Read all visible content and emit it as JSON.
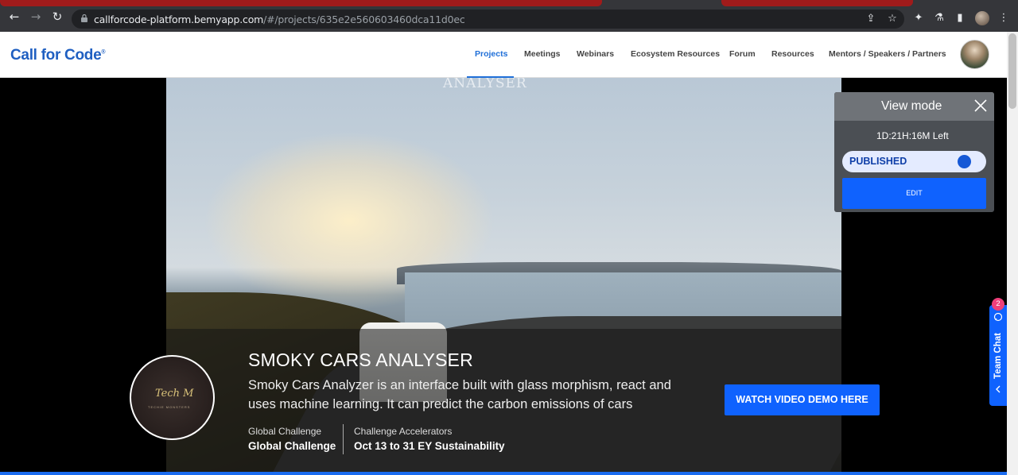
{
  "browser": {
    "url_host": "callforcode-platform.bemyapp.com",
    "url_path": "/#/projects/635e2e560603460dca11d0ec"
  },
  "header": {
    "logo": "Call for Code",
    "logo_mark": "®",
    "nav": [
      {
        "label": "Projects",
        "active": true
      },
      {
        "label": "Meetings"
      },
      {
        "label": "Webinars"
      },
      {
        "label": "Ecosystem Resources"
      },
      {
        "label": "Forum"
      },
      {
        "label": "Resources"
      },
      {
        "label": "Mentors / Speakers / Partners"
      }
    ]
  },
  "hero": {
    "watermark": "ANALYSER",
    "title": "SMOKY CARS ANALYSER",
    "description": "Smoky Cars Analyzer is an interface built with glass morphism, react and uses machine learning. It can predict the carbon emissions of cars",
    "logo_text": "Tech M",
    "logo_subtext": "TECHIE MONSTERS",
    "meta": [
      {
        "label": "Global Challenge",
        "value": "Global Challenge"
      },
      {
        "label": "Challenge Accelerators",
        "value": "Oct 13 to 31 EY Sustainability"
      }
    ],
    "watch_button": "WATCH VIDEO DEMO HERE"
  },
  "view_mode": {
    "title": "View mode",
    "time_left": "1D:21H:16M Left",
    "status": "PUBLISHED",
    "edit_label": "EDIT"
  },
  "team_chat": {
    "label": "Team Chat",
    "badge": "2"
  },
  "colors": {
    "brand": "#1f5fc1",
    "primary_button": "#0f62fe",
    "active_nav": "#1f6fd8",
    "badge": "#ee3f7a"
  }
}
